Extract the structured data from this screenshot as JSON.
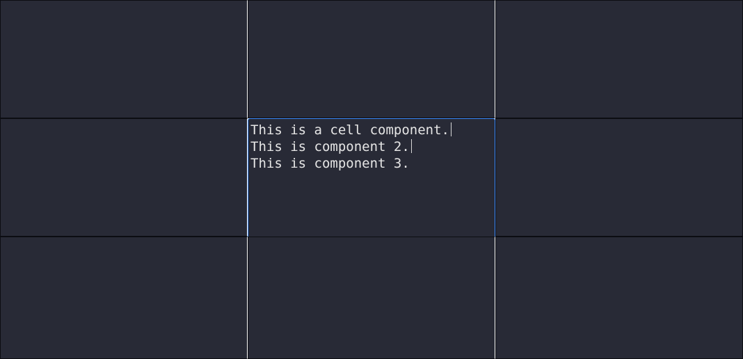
{
  "editor": {
    "lines": [
      "This is a cell component.",
      "This is component 2.",
      "This is component 3."
    ]
  }
}
